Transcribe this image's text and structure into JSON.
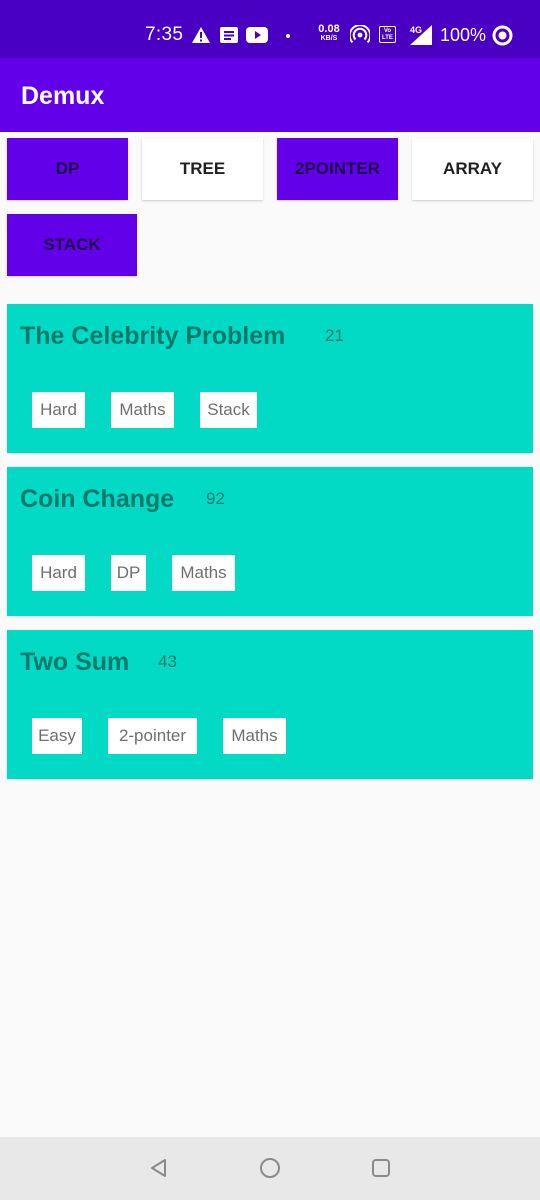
{
  "status_bar": {
    "time": "7:35",
    "net_speed_value": "0.08",
    "net_speed_unit": "KB/S",
    "volte_label": "Vo LTE",
    "network_type": "4G",
    "battery_percent": "100%"
  },
  "app_bar": {
    "title": "Demux"
  },
  "filters": [
    {
      "label": "DP",
      "active": true
    },
    {
      "label": "TREE",
      "active": false
    },
    {
      "label": "2POINTER",
      "active": true
    },
    {
      "label": "ARRAY",
      "active": false
    },
    {
      "label": "STACK",
      "active": true
    }
  ],
  "problems": [
    {
      "title": "The Celebrity Problem",
      "count": "21",
      "tags": [
        "Hard",
        "Maths",
        "Stack"
      ]
    },
    {
      "title": "Coin Change",
      "count": "92",
      "tags": [
        "Hard",
        "DP",
        "Maths"
      ]
    },
    {
      "title": "Two Sum",
      "count": "43",
      "tags": [
        "Easy",
        "2-pointer",
        "Maths"
      ]
    }
  ],
  "nav_bar": {
    "buttons": [
      "back-icon",
      "home-icon",
      "recents-icon"
    ]
  },
  "colors": {
    "status_bar": "#4a00c2",
    "primary": "#6200ea",
    "card": "#03dac5",
    "card_text": "#017a6b",
    "background": "#fafafa"
  }
}
